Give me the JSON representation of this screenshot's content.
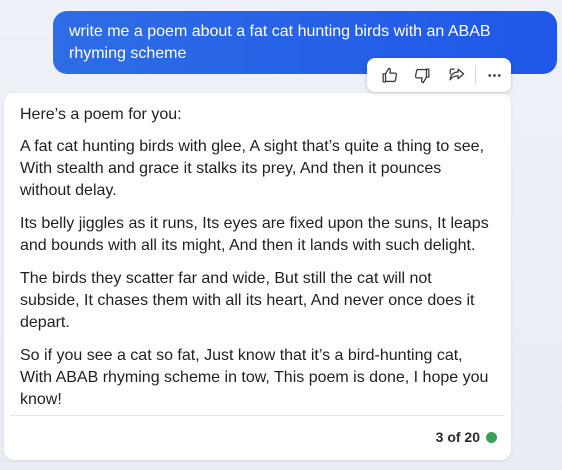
{
  "user_message": {
    "text": "write me a poem about a fat cat hunting birds with an ABAB rhyming scheme"
  },
  "actions": {
    "icons": [
      "thumbs-up-icon",
      "thumbs-down-icon",
      "share-icon",
      "more-icon"
    ]
  },
  "bot_message": {
    "intro": "Here’s a poem for you:",
    "stanzas": [
      "A fat cat hunting birds with glee, A sight that’s quite a thing to see, With stealth and grace it stalks its prey, And then it pounces without delay.",
      "Its belly jiggles as it runs, Its eyes are fixed upon the suns, It leaps and bounds with all its might, And then it lands with such delight.",
      "The birds they scatter far and wide, But still the cat will not subside, It chases them with all its heart, And never once does it depart.",
      "So if you see a cat so fat, Just know that it’s a bird-hunting cat, With ABAB rhyming scheme in tow, This poem is done, I hope you know!"
    ],
    "counter": "3 of 20",
    "status_color": "#3aa05a"
  },
  "colors": {
    "user_bubble": "#2563eb",
    "card_bg": "#ffffff",
    "page_bg": "#eef1f7"
  }
}
